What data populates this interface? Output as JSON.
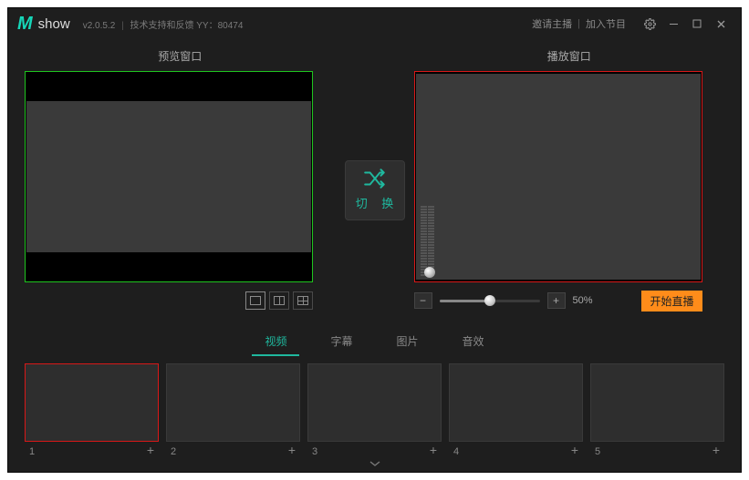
{
  "app": {
    "name": "show",
    "version": "v2.0.5.2",
    "support_text": "技术支持和反馈 YY：80474"
  },
  "header_links": {
    "invite": "邀请主播",
    "join": "加入节目"
  },
  "windows": {
    "preview_title": "预览窗口",
    "play_title": "播放窗口"
  },
  "switch": {
    "label": "切 换"
  },
  "volume": {
    "percent_text": "50%",
    "percent": 50
  },
  "start_live": {
    "label": "开始直播"
  },
  "tabs": [
    {
      "label": "视频",
      "active": true
    },
    {
      "label": "字幕",
      "active": false
    },
    {
      "label": "图片",
      "active": false
    },
    {
      "label": "音效",
      "active": false
    }
  ],
  "slots": [
    {
      "num": "1",
      "selected": true
    },
    {
      "num": "2",
      "selected": false
    },
    {
      "num": "3",
      "selected": false
    },
    {
      "num": "4",
      "selected": false
    },
    {
      "num": "5",
      "selected": false
    }
  ]
}
